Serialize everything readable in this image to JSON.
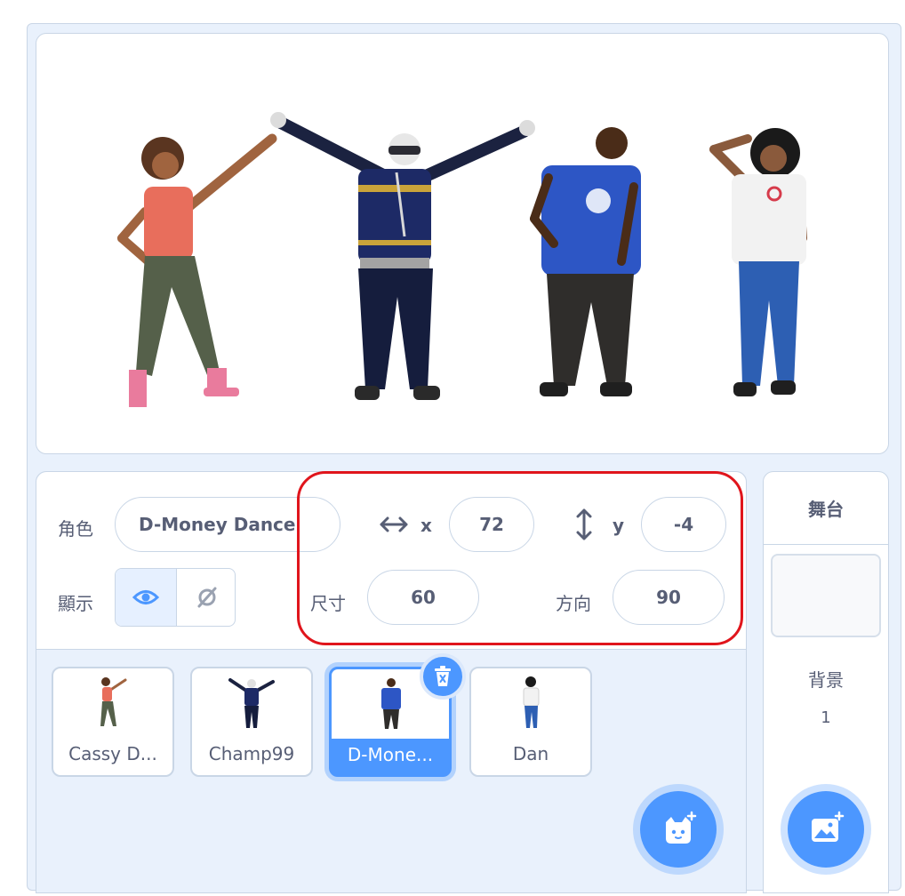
{
  "sprite_info": {
    "sprite_label": "角色",
    "sprite_name": "D-Money Dance",
    "x_label": "x",
    "x_value": "72",
    "y_label": "y",
    "y_value": "-4",
    "show_label": "顯示",
    "size_label": "尺寸",
    "size_value": "60",
    "direction_label": "方向",
    "direction_value": "90"
  },
  "sprites": [
    {
      "name": "Cassy D...",
      "selected": false
    },
    {
      "name": "Champ99",
      "selected": false
    },
    {
      "name": "D-Mone...",
      "selected": true
    },
    {
      "name": "Dan",
      "selected": false
    }
  ],
  "stage_panel": {
    "title": "舞台",
    "backdrop_label": "背景",
    "backdrop_count": "1"
  },
  "icons": [
    "show-eye-icon",
    "hide-icon",
    "x-arrows-icon",
    "y-arrows-icon",
    "trash-icon",
    "choose-sprite-cat-icon",
    "choose-backdrop-icon"
  ],
  "colors": {
    "accent": "#4c97ff",
    "highlight": "#e0151c",
    "text": "#575e75",
    "panel": "#e9f1fc"
  }
}
